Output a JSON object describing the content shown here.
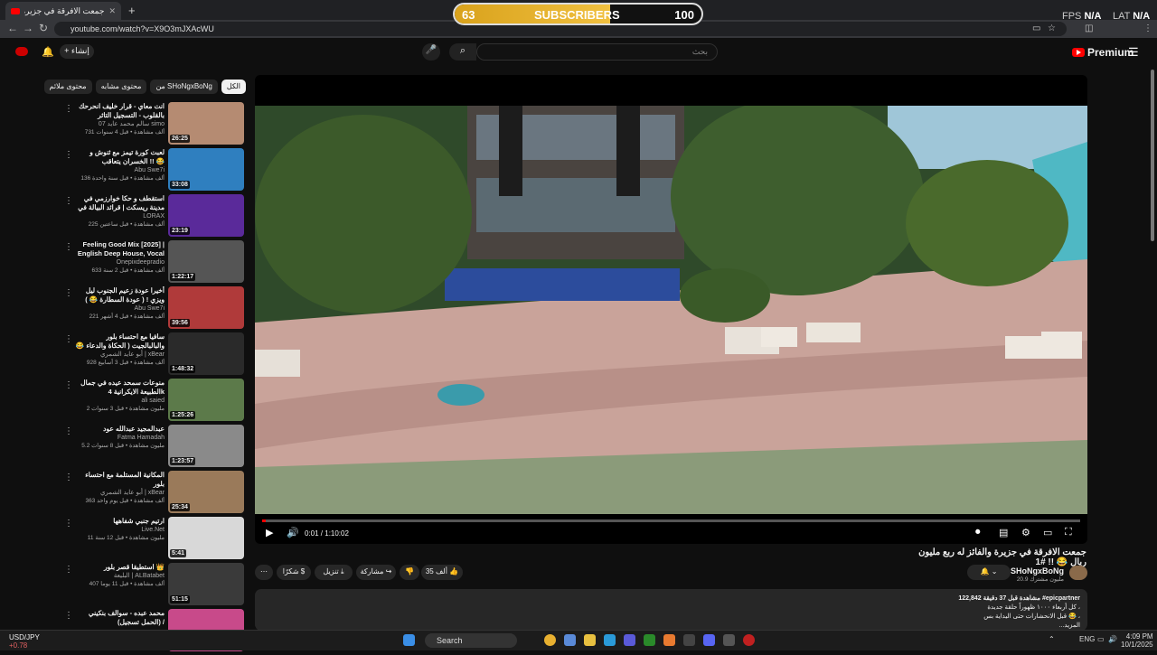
{
  "browser": {
    "tab_title": "جمعت الافرقة في جزيرة والفائز له",
    "url": "youtube.com/watch?v=X9O3mJXAcWU"
  },
  "overlay": {
    "subs_current": "63",
    "subs_label": "SUBSCRIBERS",
    "subs_goal": "100",
    "subs_progress": 0.63,
    "fps_label": "FPS",
    "fps_value": "N/A",
    "lat_label": "LAT",
    "lat_value": "N/A"
  },
  "header": {
    "logo_text": "Premium",
    "search_placeholder": "بحث",
    "create_label": "إنشاء"
  },
  "chips": [
    "الكل",
    "من SHoNgxBoNg",
    "محتوى مشابه",
    "محتوى ملائم"
  ],
  "related": [
    {
      "title": "انت معاي - قرار خليف انحرحك بالقلوب - التسجيل التاثر والحصري | لأول مره في ...",
      "channel": "سالم محمد عايد 07 simo",
      "meta": "731 ألف مشاهدة • قبل 4 سنوات",
      "duration": "26:25",
      "bg": "#b58b72"
    },
    {
      "title": "لعبت كورة تيمز مع ثنوش و الخسران يتعاقب !! 😂",
      "channel": "Abu Swe7i",
      "meta": "136 ألف مشاهدة • قبل سنة واحدة",
      "duration": "33:08",
      "bg": "#2f7fbf"
    },
    {
      "title": "استقطف و حكا خوارزمي في مدينة ريسكت | قرائد البيالة في الاجمارك/ريسكت gta",
      "channel": "LORAX",
      "meta": "225 ألف مشاهدة • قبل ساعتين",
      "duration": "23:19",
      "bg": "#5a2a9a"
    },
    {
      "title": "Feeling Good Mix [2025] | English Deep House, Vocal ...",
      "channel": "Onepixdeepradio",
      "meta": "633 ألف مشاهدة • قبل 2 سنة",
      "duration": "1:22:17",
      "bg": "#555555"
    },
    {
      "title": "أخيرا عودة زعيم الجنوب ليل ويزي ! ( عودة السطارة 😂 )",
      "channel": "Abu Swe7i",
      "meta": "221 ألف مشاهدة • قبل 4 أشهر",
      "duration": "39:56",
      "bg": "#b03a3a"
    },
    {
      "title": "سافيا مع احتساء بلور والبالبالجيت ( الحكاة والدعاء 😂 )",
      "channel": "أبو عايد الشمري | xBear",
      "meta": "928 ألف مشاهدة • قبل 3 أسابيع",
      "duration": "1:48:32",
      "bg": "#2a2a2a"
    },
    {
      "title": "منوعات سمحد عيده في جمال الطبيعة الايكرانية 4k",
      "channel": "ali saied",
      "meta": "2 مليون مشاهدة • قبل 3 سنوات",
      "duration": "1:25:26",
      "bg": "#5c7a4a"
    },
    {
      "title": "عبدالمجيد عبدالله عود",
      "channel": "Fatma Hamadah",
      "meta": "5.2 مليون مشاهدة • قبل 8 سنوات",
      "duration": "1:23:57",
      "bg": "#8a8a8a"
    },
    {
      "title": "المكانية المستلمة مع احتساء بلور",
      "channel": "أبو عايد الشمري | xBear",
      "meta": "363 ألف مشاهدة • قبل يوم واحد",
      "duration": "25:34",
      "bg": "#9a7a5a"
    },
    {
      "title": "ارتيم جنبي شفاهها",
      "channel": "Live.Net",
      "meta": "11 مليون مشاهدة • قبل 12 سنة",
      "duration": "5:41",
      "bg": "#d8d8d8"
    },
    {
      "title": "استطيقا قصر بلور 👑",
      "channel": "البليعة | ALBatabet",
      "meta": "407 ألف مشاهدة • قبل 11 يوما",
      "duration": "51:15",
      "bg": "#3a3a3a"
    },
    {
      "title": "محمد عبده - سوالف بنكيني (الحمل تسجيل) /",
      "channel": "",
      "meta": "",
      "duration": "",
      "bg": "#c84a8a"
    }
  ],
  "player": {
    "time": "0:01 / 1:10:02",
    "progress": 0.0002
  },
  "video": {
    "title": "جمعت الافرقة في جزيرة والفائز له ربع مليون ريال 😂 !! #1",
    "channel": "SHoNgxBoNg",
    "subs": "20.9 مليون مشترك",
    "likes": "35 ألف",
    "share": "مشاركة",
    "download": "تنزيل",
    "thanks": "شكرًا"
  },
  "description": {
    "line1": "122,842 مشاهدة قبل 37 دقيقة #epicpartner",
    "line2": "كل أربعاء ١٠٠٠ ظهوراً حلقة جديدة ،",
    "line3": "قبل الانحشارات حتى اليداية بس 😂 ،",
    "more": "...المزيد"
  },
  "taskbar": {
    "ticker": "USD/JPY",
    "ticker_change": "+0.78",
    "search": "Search",
    "lang": "ENG",
    "time": "4:09 PM",
    "date": "10/1/2025"
  }
}
